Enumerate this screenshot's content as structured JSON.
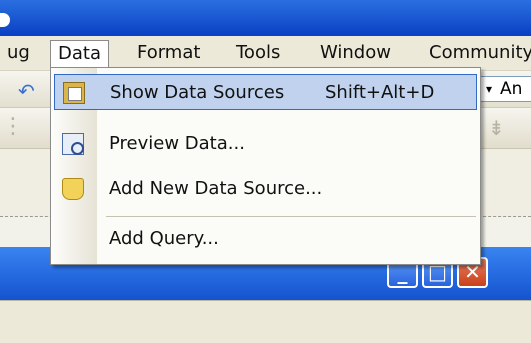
{
  "menubar": {
    "items": [
      "ug",
      "Data",
      "Format",
      "Tools",
      "Window",
      "Community"
    ],
    "active_index": 1
  },
  "toolbar": {
    "combo_text": "An",
    "combo_arrow": "▾",
    "undo_glyph": "↶"
  },
  "data_menu": {
    "items": [
      {
        "label": "Show Data Sources",
        "shortcut": "Shift+Alt+D",
        "icon": "data-sources-icon",
        "highlighted": true
      },
      {
        "label": "Preview Data...",
        "shortcut": "",
        "icon": "preview-data-icon",
        "highlighted": false
      },
      {
        "label": "Add New Data Source...",
        "shortcut": "",
        "icon": "add-data-source-icon",
        "highlighted": false
      },
      {
        "label": "Add Query...",
        "shortcut": "",
        "icon": "",
        "highlighted": false
      }
    ]
  },
  "window_controls": {
    "minimize_glyph": "_",
    "maximize_glyph": "□",
    "close_glyph": "✕"
  },
  "colors": {
    "xp_blue": "#1f5fd6",
    "menu_highlight": "#c1d2ee",
    "highlight_border": "#316ac5",
    "close_red": "#c8411b"
  }
}
